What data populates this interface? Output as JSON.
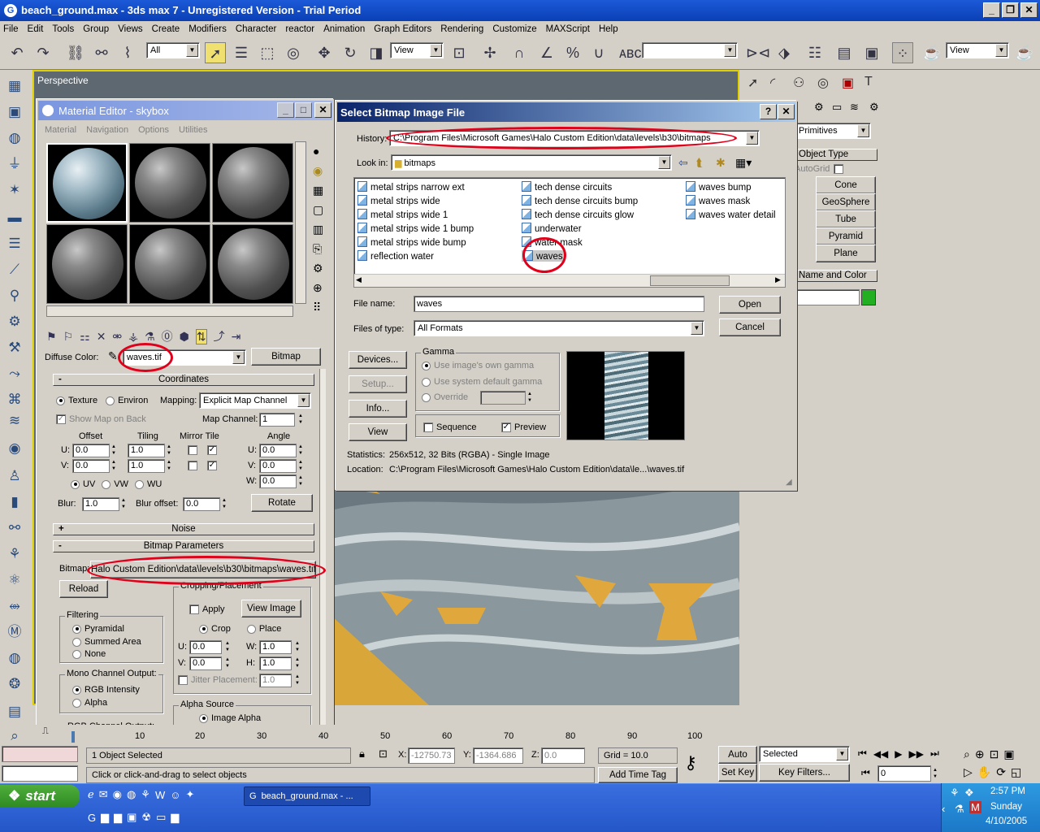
{
  "window": {
    "title": "beach_ground.max - 3ds max 7 - Unregistered Version - Trial Period",
    "min": "_",
    "max": "❐",
    "close": "✕"
  },
  "menu": [
    "File",
    "Edit",
    "Tools",
    "Group",
    "Views",
    "Create",
    "Modifiers",
    "Character",
    "reactor",
    "Animation",
    "Graph Editors",
    "Rendering",
    "Customize",
    "MAXScript",
    "Help"
  ],
  "toolbar": {
    "selection_filter": "All",
    "ref_coord": "View",
    "ref_coord2": "View"
  },
  "viewport": {
    "label": "Perspective"
  },
  "command_panel": {
    "category": "Primitives",
    "rollout_object_type": "Object Type",
    "autogrid": "AutoGrid",
    "buttons": [
      "Cone",
      "GeoSphere",
      "Tube",
      "Pyramid",
      "Plane"
    ],
    "rollout_name_color": "Name and Color",
    "object_color": "#22b022"
  },
  "material_editor": {
    "title": "Material Editor - skybox",
    "menu": [
      "Material",
      "Navigation",
      "Options",
      "Utilities"
    ],
    "diffuse_label": "Diffuse Color:",
    "map_name": "waves.tif",
    "map_type": "Bitmap",
    "coordinates": {
      "title": "Coordinates",
      "texture": "Texture",
      "environ": "Environ",
      "mapping_label": "Mapping:",
      "mapping": "Explicit Map Channel",
      "show_map": "Show Map on Back",
      "map_channel_label": "Map Channel:",
      "map_channel": "1",
      "offset": "Offset",
      "tiling": "Tiling",
      "mirror_tile": "Mirror Tile",
      "angle": "Angle",
      "u": "U:",
      "v": "V:",
      "w": "W:",
      "u_offset": "0.0",
      "v_offset": "0.0",
      "u_tiling": "1.0",
      "v_tiling": "1.0",
      "u_angle": "0.0",
      "v_angle": "0.0",
      "w_angle": "0.0",
      "uv": "UV",
      "vw": "VW",
      "wu": "WU",
      "blur_label": "Blur:",
      "blur": "1.0",
      "blur_offset_label": "Blur offset:",
      "blur_offset": "0.0",
      "rotate": "Rotate"
    },
    "noise": "Noise",
    "bitmap_params": {
      "title": "Bitmap Parameters",
      "bitmap_label": "Bitmap:",
      "path": "Halo Custom Edition\\data\\levels\\b30\\bitmaps\\waves.tif",
      "reload": "Reload",
      "cropping": "Cropping/Placement",
      "apply": "Apply",
      "view_image": "View Image",
      "crop": "Crop",
      "place": "Place",
      "u": "U:",
      "v": "V:",
      "w": "W:",
      "h": "H:",
      "crop_u": "0.0",
      "crop_v": "0.0",
      "crop_w": "1.0",
      "crop_h": "1.0",
      "jitter": "Jitter Placement:",
      "jitter_val": "1.0",
      "filtering": "Filtering",
      "pyramidal": "Pyramidal",
      "summed": "Summed Area",
      "none": "None",
      "mono": "Mono Channel Output:",
      "rgb_intensity": "RGB Intensity",
      "alpha": "Alpha",
      "alpha_source": "Alpha Source",
      "image_alpha": "Image Alpha",
      "rgb_channel": "RGB Channel Output:"
    }
  },
  "dialog": {
    "title": "Select Bitmap Image File",
    "help": "?",
    "close": "✕",
    "history_label": "History:",
    "history": "C:\\Program Files\\Microsoft Games\\Halo Custom Edition\\data\\levels\\b30\\bitmaps",
    "lookin_label": "Look in:",
    "lookin": "bitmaps",
    "files": {
      "col1": [
        "metal strips narrow ext",
        "metal strips wide",
        "metal strips wide 1",
        "metal strips wide 1 bump",
        "metal strips wide bump",
        "reflection water"
      ],
      "col2": [
        "tech dense circuits",
        "tech dense circuits bump",
        "tech dense circuits glow",
        "underwater",
        "water mask",
        "waves"
      ],
      "col3": [
        "waves bump",
        "waves mask",
        "waves water detail"
      ]
    },
    "filename_label": "File name:",
    "filename": "waves",
    "filetype_label": "Files of type:",
    "filetype": "All Formats",
    "open": "Open",
    "cancel": "Cancel",
    "devices": "Devices...",
    "setup": "Setup...",
    "info": "Info...",
    "view": "View",
    "gamma": "Gamma",
    "gamma_own": "Use image's own gamma",
    "gamma_sys": "Use system default gamma",
    "gamma_override": "Override",
    "sequence": "Sequence",
    "preview": "Preview",
    "statistics_label": "Statistics:",
    "statistics": "256x512, 32 Bits (RGBA) - Single Image",
    "location_label": "Location:",
    "location": "C:\\Program Files\\Microsoft Games\\Halo Custom Edition\\data\\le...\\waves.tif"
  },
  "timeline": {
    "ticks": [
      "0",
      "10",
      "20",
      "30",
      "40",
      "50",
      "60",
      "70",
      "80",
      "90",
      "100"
    ]
  },
  "status": {
    "selected": "1 Object Selected",
    "prompt": "Click or click-and-drag to select objects",
    "x_label": "X:",
    "y_label": "Y:",
    "z_label": "Z:",
    "x": "-12750.73",
    "y": "-1364.686",
    "z": "0.0",
    "grid": "Grid = 10.0",
    "add_time_tag": "Add Time Tag",
    "auto_key": "Auto Key",
    "set_key": "Set Key",
    "key_mode": "Selected",
    "key_filters": "Key Filters...",
    "frame": "0"
  },
  "taskbar": {
    "start": "start",
    "task": "beach_ground.max - ...",
    "time": "2:57 PM",
    "day": "Sunday",
    "date": "4/10/2005"
  }
}
